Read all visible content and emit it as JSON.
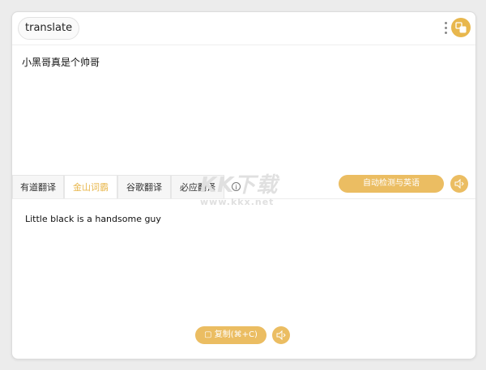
{
  "header": {
    "search_value": "translate"
  },
  "source": {
    "text": "小黑哥真是个帅哥"
  },
  "tabs": [
    {
      "label": "有道翻译"
    },
    {
      "label": "金山词霸"
    },
    {
      "label": "谷歌翻译"
    },
    {
      "label": "必应翻译"
    }
  ],
  "detect_label": "自动检测与英语",
  "result": {
    "text": "Little black is a handsome guy"
  },
  "copy_label": "复制(⌘+C)",
  "watermark": {
    "main": "KK下载",
    "sub": "www.kkx.net"
  },
  "colors": {
    "accent": "#ebbd62",
    "active_tab_text": "#e8b74d"
  }
}
